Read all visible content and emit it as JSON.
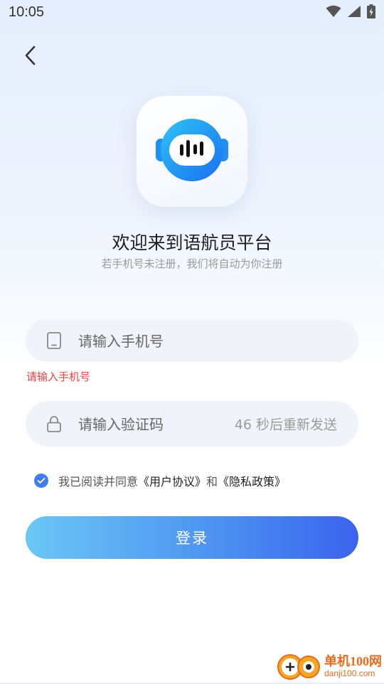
{
  "status_bar": {
    "time": "10:05"
  },
  "welcome": {
    "title": "欢迎来到语航员平台",
    "subtitle": "若手机号未注册，我们将自动为你注册"
  },
  "phone": {
    "placeholder": "请输入手机号",
    "error": "请输入手机号"
  },
  "code": {
    "placeholder": "请输入验证码",
    "countdown": "46 秒后重新发送"
  },
  "agreement": {
    "prefix": "我已阅读并同意",
    "user_agreement": "《用户协议》",
    "conj": "和",
    "privacy_policy": "《隐私政策》",
    "checked": true
  },
  "login": {
    "label": "登录"
  },
  "watermark": {
    "brand": "单机100网",
    "url": "danji100.com"
  },
  "colors": {
    "accent": "#3f7cf1",
    "error": "#e64340",
    "button_start": "#6cc7f5",
    "button_end": "#3a63ee",
    "watermark": "#e86b1d"
  },
  "icons": {
    "back": "chevron-left-icon",
    "phone": "phone-icon",
    "lock": "lock-icon",
    "check": "check-icon",
    "wifi": "wifi-icon",
    "signal": "signal-icon",
    "battery": "battery-icon"
  }
}
